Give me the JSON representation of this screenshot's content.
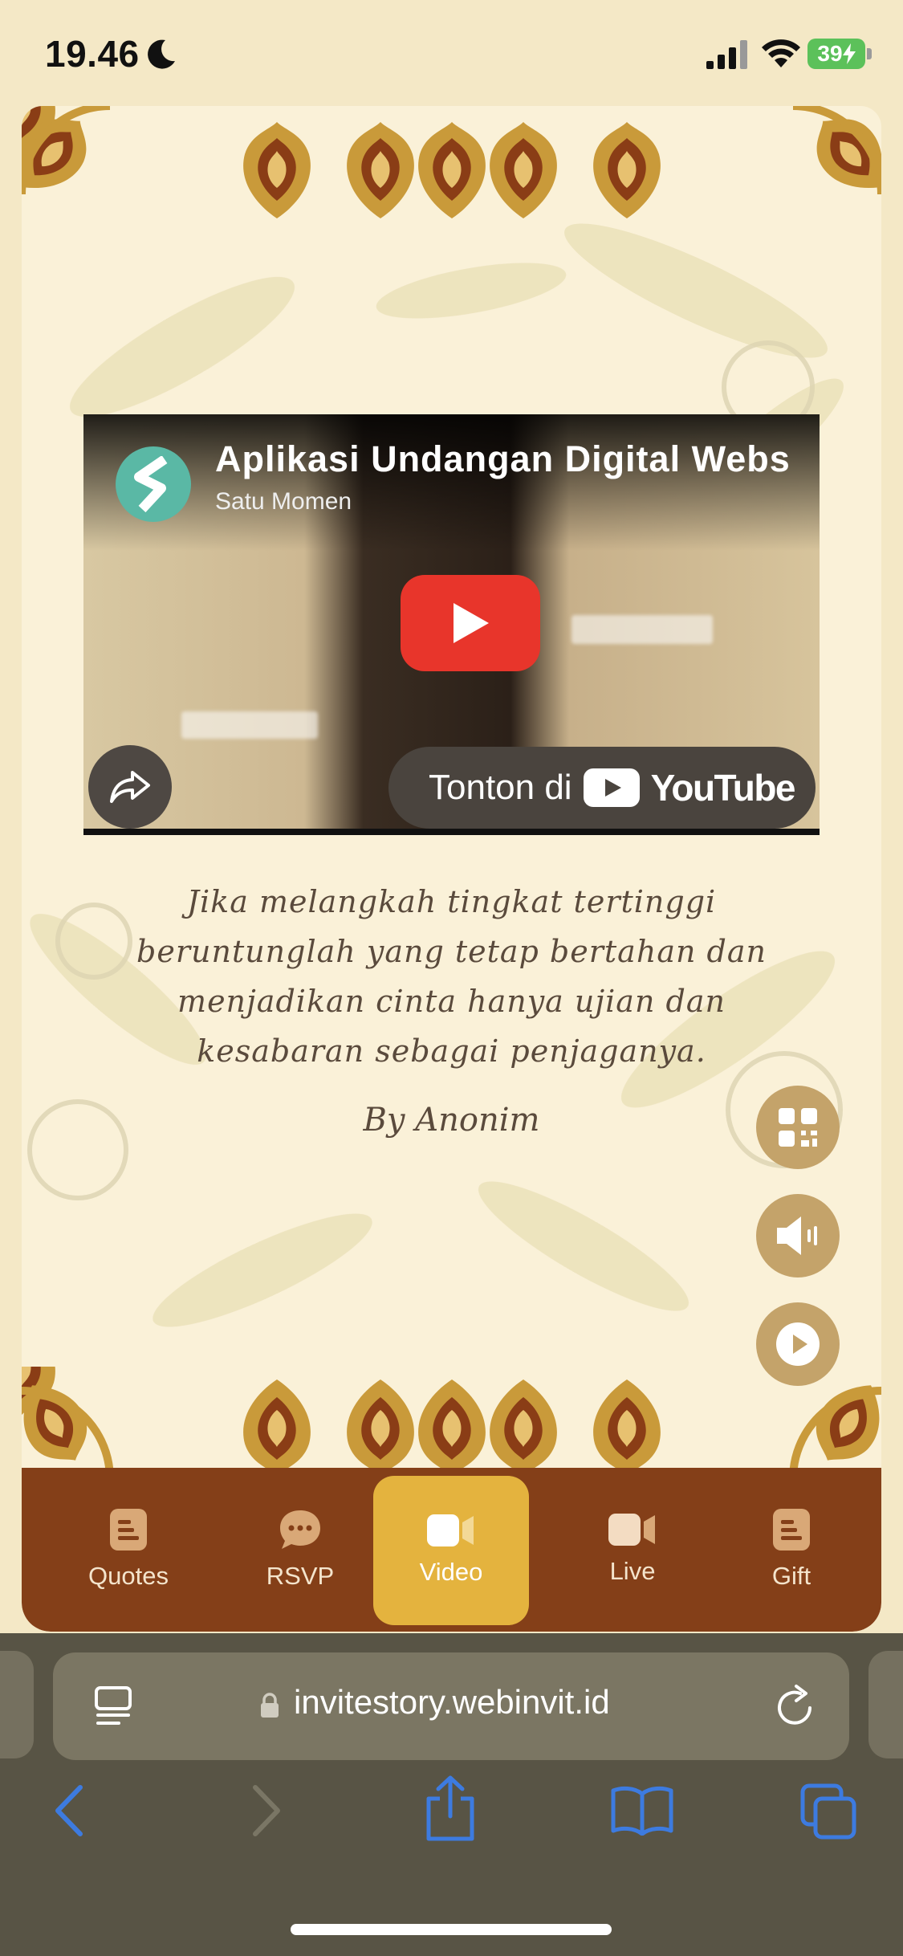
{
  "status_bar": {
    "time": "19.46",
    "battery": "39"
  },
  "video": {
    "title": "Aplikasi Undangan Digital Webs",
    "channel": "Satu Momen",
    "watch_on": "Tonton di",
    "youtube_word": "YouTube"
  },
  "quote": {
    "text": "Jika melangkah tingkat tertinggi beruntunglah yang tetap bertahan dan menjadikan cinta hanya ujian dan kesabaran sebagai penjaganya.",
    "author": "By Anonim"
  },
  "bottom_nav": {
    "items": [
      {
        "label": "Quotes",
        "icon": "document-icon"
      },
      {
        "label": "RSVP",
        "icon": "chat-icon"
      },
      {
        "label": "Video",
        "icon": "video-icon",
        "active": true
      },
      {
        "label": "Live",
        "icon": "video-icon"
      },
      {
        "label": "Gift",
        "icon": "document-icon"
      }
    ]
  },
  "browser": {
    "url": "invitestory.webinvit.id"
  },
  "colors": {
    "page_bg": "#f4e8c6",
    "card_bg": "#faf1d8",
    "nav_bg": "#843f18",
    "nav_active": "#e4b33e",
    "fab": "#c4a36a",
    "ornament_gold": "#c99a3a",
    "ornament_brown": "#8a3d16",
    "browser_bg": "#585445",
    "ios_blue": "#3d7be0"
  }
}
